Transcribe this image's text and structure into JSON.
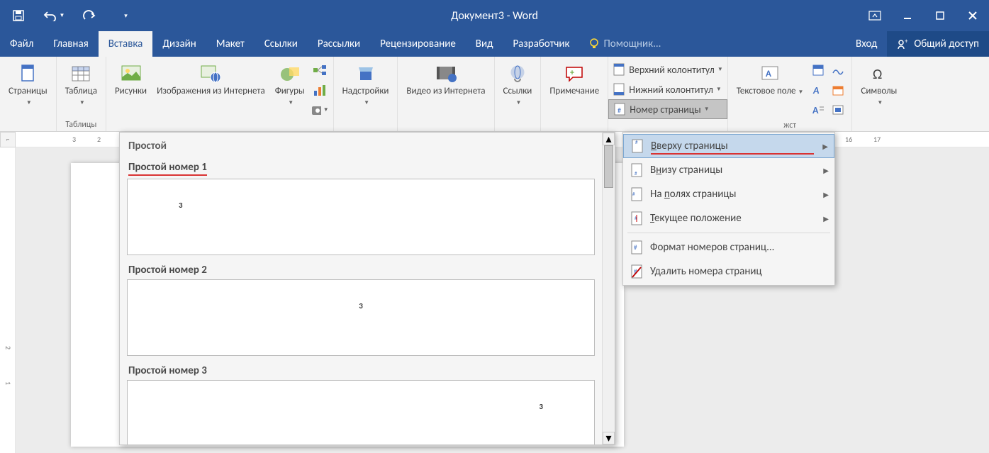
{
  "title": "Документ3 - Word",
  "tabs": {
    "file": "Файл",
    "home": "Главная",
    "insert": "Вставка",
    "design": "Дизайн",
    "layout": "Макет",
    "references": "Ссылки",
    "mailings": "Рассылки",
    "review": "Рецензирование",
    "view": "Вид",
    "developer": "Разработчик",
    "tell": "Помощник...",
    "signin": "Вход",
    "share": "Общий доступ"
  },
  "ribbon": {
    "pages": {
      "btn": "Страницы"
    },
    "tables": {
      "btn": "Таблица",
      "label": "Таблицы"
    },
    "illustrations": {
      "pictures": "Рисунки",
      "online": "Изображения из Интернета",
      "shapes": "Фигуры"
    },
    "addins": {
      "btn": "Надстройки"
    },
    "media": {
      "btn": "Видео из Интернета"
    },
    "links": {
      "btn": "Ссылки"
    },
    "comments": {
      "btn": "Примечание"
    },
    "headerfooter": {
      "header": "Верхний колонтитул",
      "footer": "Нижний колонтитул",
      "page_number": "Номер страницы"
    },
    "text": {
      "btn": "Текстовое поле",
      "label_fragment": "жст"
    },
    "symbols": {
      "btn": "Символы"
    }
  },
  "gallery": {
    "heading": "Простой",
    "items": [
      "Простой номер 1",
      "Простой номер 2",
      "Простой номер 3"
    ],
    "sample": "3"
  },
  "submenu": {
    "top": "Вверху страницы",
    "bottom": "Внизу страницы",
    "margins": "На полях страницы",
    "current": "Текущее положение",
    "format": "Формат номеров страниц...",
    "remove": "Удалить номера страниц"
  },
  "ruler": {
    "marks": [
      "3",
      "2",
      "1",
      "16",
      "17"
    ]
  }
}
